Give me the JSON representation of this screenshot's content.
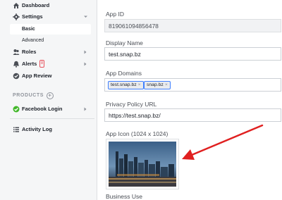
{
  "sidebar": {
    "items": [
      {
        "label": "Dashboard",
        "icon": "home-icon"
      },
      {
        "label": "Settings",
        "icon": "gear-icon"
      },
      {
        "label": "Roles",
        "icon": "people-icon"
      },
      {
        "label": "Alerts",
        "icon": "bell-icon",
        "badge": "8"
      },
      {
        "label": "App Review",
        "icon": "checkmark-shield-icon"
      }
    ],
    "settings_sub": [
      "Basic",
      "Advanced"
    ],
    "products_heading": "PRODUCTS",
    "product_items": [
      {
        "label": "Facebook Login",
        "icon": "green-check-icon"
      }
    ],
    "activity_log": "Activity Log"
  },
  "form": {
    "app_id": {
      "label": "App ID",
      "value": "819061094856478"
    },
    "display_name": {
      "label": "Display Name",
      "value": "test.snap.bz"
    },
    "app_domains": {
      "label": "App Domains",
      "tokens": [
        "test.snap.bz",
        "snap.bz"
      ]
    },
    "privacy_url": {
      "label": "Privacy Policy URL",
      "value": "https://test.snap.bz/"
    },
    "app_icon": {
      "label": "App Icon (1024 x 1024)"
    },
    "business_use": {
      "label": "Business Use"
    }
  },
  "colors": {
    "accent": "#4080ff",
    "arrow": "#e02020",
    "alert": "#e8535d",
    "check": "#42b72a"
  }
}
